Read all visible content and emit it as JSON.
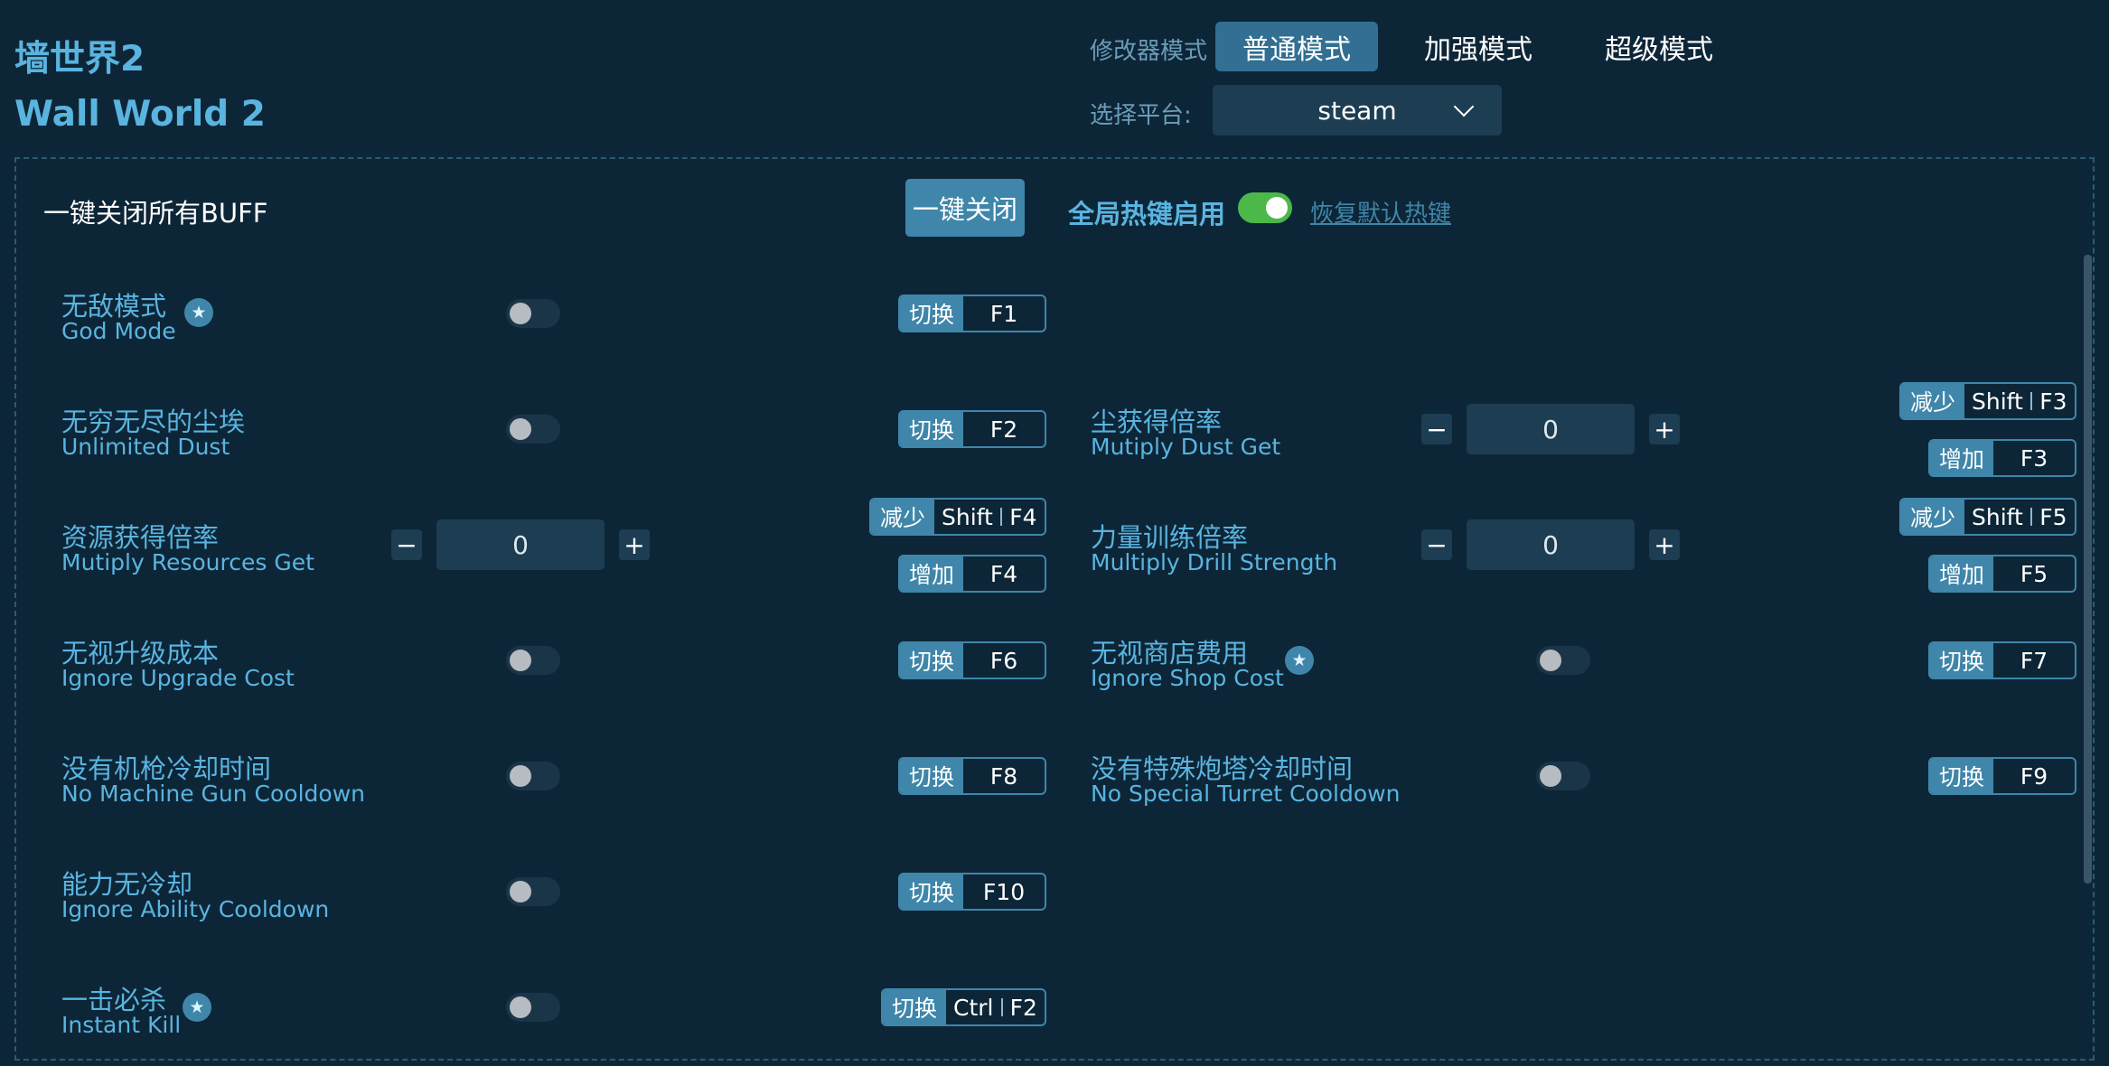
{
  "app": {
    "title_cn": "墙世界2",
    "title_en": "Wall World 2"
  },
  "header": {
    "mode_label": "修改器模式",
    "modes": [
      "普通模式",
      "加强模式",
      "超级模式"
    ],
    "platform_label": "选择平台:",
    "platform_value": "steam"
  },
  "toolbar": {
    "buff_label": "一键关闭所有BUFF",
    "close_all": "一键关闭",
    "hotkey_label": "全局热键启用",
    "hotkey_enabled": true,
    "restore_link": "恢复默认热键"
  },
  "options": {
    "god_mode": {
      "cn": "无敌模式",
      "en": "God Mode",
      "action": "切换",
      "key": "F1",
      "on": false
    },
    "unlimited_dust": {
      "cn": "无穷无尽的尘埃",
      "en": "Unlimited Dust",
      "action": "切换",
      "key": "F2",
      "on": false
    },
    "dust_get": {
      "cn": "尘获得倍率",
      "en": "Mutiply Dust Get",
      "value": "0",
      "dec_action": "减少",
      "dec_mod": "Shift",
      "dec_key": "F3",
      "inc_action": "增加",
      "inc_key": "F3"
    },
    "resources_get": {
      "cn": "资源获得倍率",
      "en": "Mutiply Resources Get",
      "value": "0",
      "dec_action": "减少",
      "dec_mod": "Shift",
      "dec_key": "F4",
      "inc_action": "增加",
      "inc_key": "F4"
    },
    "drill_strength": {
      "cn": "力量训练倍率",
      "en": "Multiply Drill Strength",
      "value": "0",
      "dec_action": "减少",
      "dec_mod": "Shift",
      "dec_key": "F5",
      "inc_action": "增加",
      "inc_key": "F5"
    },
    "upgrade_cost": {
      "cn": "无视升级成本",
      "en": "Ignore Upgrade Cost",
      "action": "切换",
      "key": "F6",
      "on": false
    },
    "shop_cost": {
      "cn": "无视商店费用",
      "en": "Ignore Shop Cost",
      "action": "切换",
      "key": "F7",
      "on": false
    },
    "mg_cooldown": {
      "cn": "没有机枪冷却时间",
      "en": "No Machine Gun Cooldown",
      "action": "切换",
      "key": "F8",
      "on": false
    },
    "turret_cooldown": {
      "cn": "没有特殊炮塔冷却时间",
      "en": "No Special Turret Cooldown",
      "action": "切换",
      "key": "F9",
      "on": false
    },
    "ability_cooldown": {
      "cn": "能力无冷却",
      "en": "Ignore Ability Cooldown",
      "action": "切换",
      "key": "F10",
      "on": false
    },
    "instant_kill": {
      "cn": "一击必杀",
      "en": "Instant Kill",
      "action": "切换",
      "mod": "Ctrl",
      "key": "F2",
      "on": false
    }
  },
  "icons": {
    "star": "star-icon",
    "chevron": "chevron-down-icon",
    "minus": "minus-icon",
    "plus": "plus-icon"
  },
  "colors": {
    "background": "#0d2637",
    "accent": "#3f86aa",
    "title": "#5ab4e0",
    "toggle_on": "#4cb84a"
  }
}
